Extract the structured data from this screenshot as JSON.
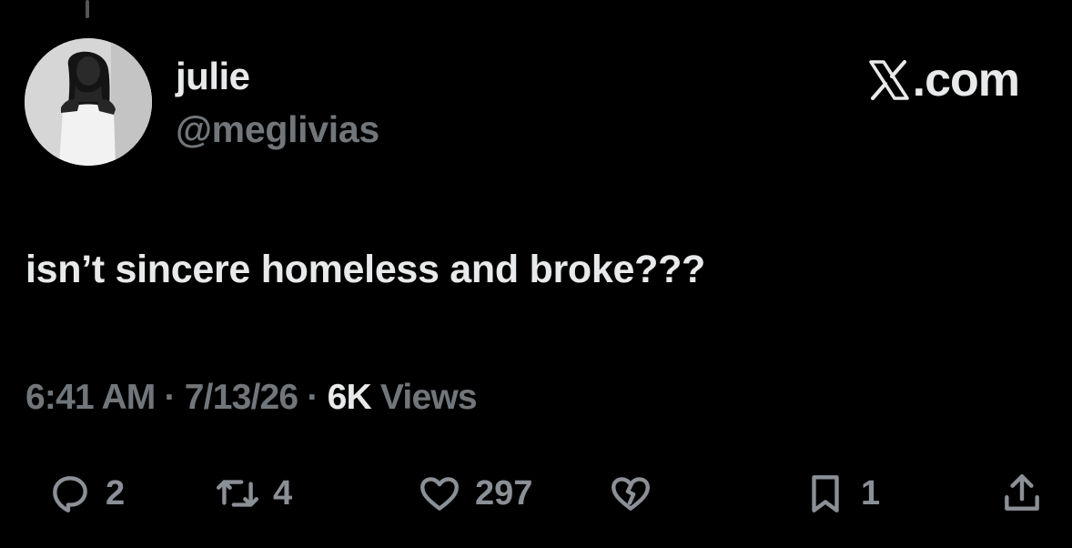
{
  "author": {
    "display_name": "julie",
    "handle": "@meglivias"
  },
  "brand": {
    "logo_icon": "x-logo-icon",
    "domain_text": ".com"
  },
  "tweet": {
    "text": "isn’t sincere homeless and broke???",
    "time": "6:41 AM",
    "date": "7/13/26",
    "views_count": "6K",
    "views_label": "Views",
    "separator": "·"
  },
  "actions": {
    "replies": "2",
    "reposts": "4",
    "likes": "297",
    "bookmarks": "1"
  },
  "colors": {
    "background": "#000000",
    "primary_text": "#e7e9ea",
    "secondary_text": "#71767b"
  }
}
